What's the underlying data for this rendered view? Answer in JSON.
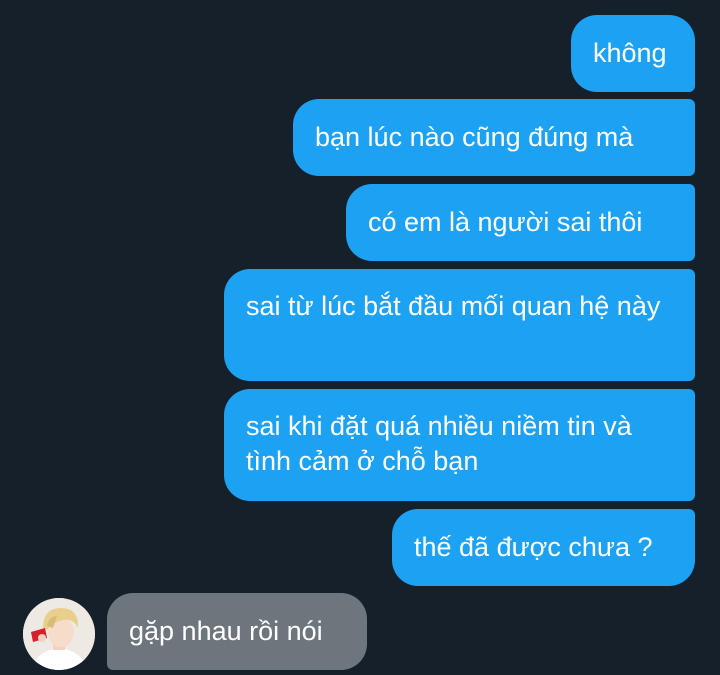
{
  "messages": [
    {
      "side": "sent",
      "text": "không"
    },
    {
      "side": "sent",
      "text": "bạn lúc nào cũng đúng mà"
    },
    {
      "side": "sent",
      "text": "có em là người sai thôi"
    },
    {
      "side": "sent",
      "text": "sai từ lúc bắt đầu mối quan hệ này"
    },
    {
      "side": "sent",
      "text": "sai khi đặt quá nhiều niềm tin và tình cảm ở chỗ bạn"
    },
    {
      "side": "sent",
      "text": "thế đã được chưa ?"
    },
    {
      "side": "received",
      "text": "gặp nhau rồi nói"
    }
  ],
  "colors": {
    "background": "#15202b",
    "sent_bubble": "#1da1f2",
    "received_bubble": "#6e767d",
    "text": "#ffffff"
  }
}
